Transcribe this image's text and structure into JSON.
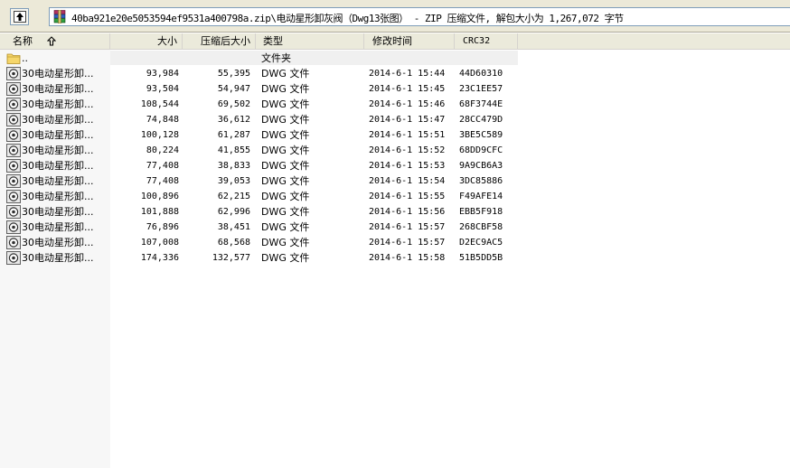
{
  "path": {
    "text": "40ba921e20e5053594ef9531a400798a.zip\\电动星形卸灰阀（Dwg13张图） - ZIP 压缩文件, 解包大小为 1,267,072 字节"
  },
  "columns": {
    "name": "名称",
    "size": "大小",
    "packed": "压缩后大小",
    "type": "类型",
    "modified": "修改时间",
    "crc": "CRC32"
  },
  "parent_row": {
    "name": "..",
    "type": "文件夹"
  },
  "files": [
    {
      "name": "30电动星形卸...",
      "size": "93,984",
      "packed": "55,395",
      "type": "DWG 文件",
      "modified": "2014-6-1 15:44",
      "crc": "44D60310"
    },
    {
      "name": "30电动星形卸...",
      "size": "93,504",
      "packed": "54,947",
      "type": "DWG 文件",
      "modified": "2014-6-1 15:45",
      "crc": "23C1EE57"
    },
    {
      "name": "30电动星形卸...",
      "size": "108,544",
      "packed": "69,502",
      "type": "DWG 文件",
      "modified": "2014-6-1 15:46",
      "crc": "68F3744E"
    },
    {
      "name": "30电动星形卸...",
      "size": "74,848",
      "packed": "36,612",
      "type": "DWG 文件",
      "modified": "2014-6-1 15:47",
      "crc": "28CC479D"
    },
    {
      "name": "30电动星形卸...",
      "size": "100,128",
      "packed": "61,287",
      "type": "DWG 文件",
      "modified": "2014-6-1 15:51",
      "crc": "3BE5C589"
    },
    {
      "name": "30电动星形卸...",
      "size": "80,224",
      "packed": "41,855",
      "type": "DWG 文件",
      "modified": "2014-6-1 15:52",
      "crc": "68DD9CFC"
    },
    {
      "name": "30电动星形卸...",
      "size": "77,408",
      "packed": "38,833",
      "type": "DWG 文件",
      "modified": "2014-6-1 15:53",
      "crc": "9A9CB6A3"
    },
    {
      "name": "30电动星形卸...",
      "size": "77,408",
      "packed": "39,053",
      "type": "DWG 文件",
      "modified": "2014-6-1 15:54",
      "crc": "3DC85886"
    },
    {
      "name": "30电动星形卸...",
      "size": "100,896",
      "packed": "62,215",
      "type": "DWG 文件",
      "modified": "2014-6-1 15:55",
      "crc": "F49AFE14"
    },
    {
      "name": "30电动星形卸...",
      "size": "101,888",
      "packed": "62,996",
      "type": "DWG 文件",
      "modified": "2014-6-1 15:56",
      "crc": "EBB5F918"
    },
    {
      "name": "30电动星形卸...",
      "size": "76,896",
      "packed": "38,451",
      "type": "DWG 文件",
      "modified": "2014-6-1 15:57",
      "crc": "268CBF58"
    },
    {
      "name": "30电动星形卸...",
      "size": "107,008",
      "packed": "68,568",
      "type": "DWG 文件",
      "modified": "2014-6-1 15:57",
      "crc": "D2EC9AC5"
    },
    {
      "name": "30电动星形卸...",
      "size": "174,336",
      "packed": "132,577",
      "type": "DWG 文件",
      "modified": "2014-6-1 15:58",
      "crc": "51B5DD5B"
    }
  ],
  "icons": {
    "up": "up-folder-icon",
    "archive": "winrar-archive-icon",
    "sort": "sort-ascending-icon",
    "parent": "folder-icon",
    "file": "dwg-file-icon"
  }
}
